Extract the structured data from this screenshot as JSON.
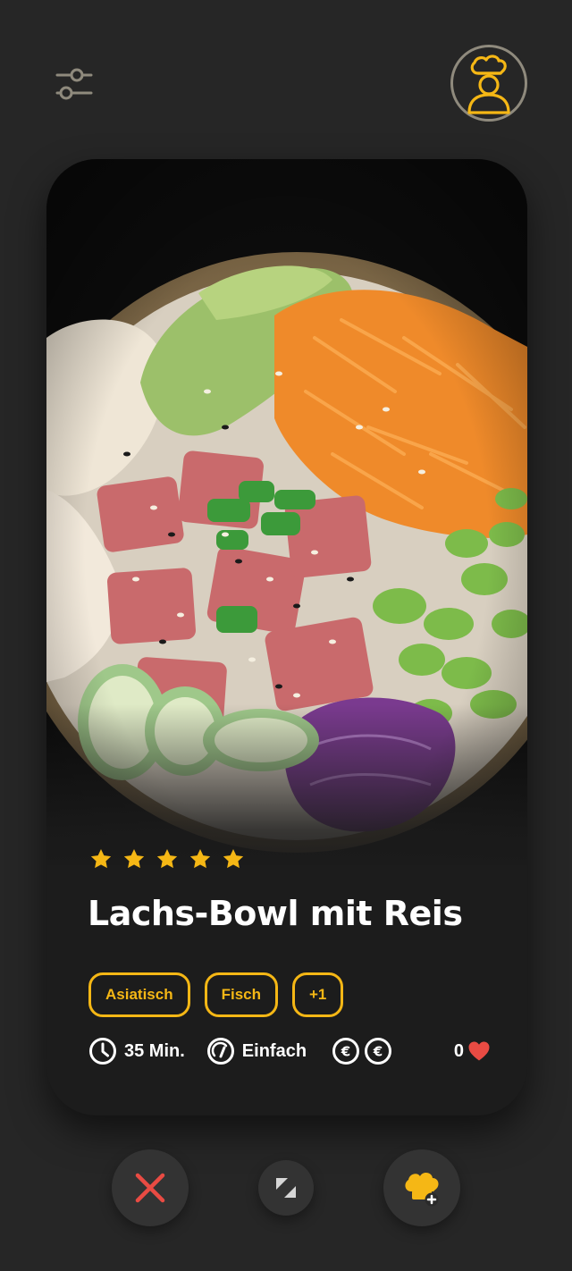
{
  "recipe": {
    "title": "Lachs-Bowl mit Reis",
    "rating": 5,
    "tags": [
      "Asiatisch",
      "Fisch",
      "+1"
    ],
    "time": "35 Min.",
    "difficulty": "Einfach",
    "cost_level": 2,
    "cost_symbol": "€",
    "likes": "0",
    "image": "salmon-poke-bowl-photo"
  },
  "icons": {
    "filter": "sliders-icon",
    "profile": "chef-avatar-icon",
    "time": "clock-icon",
    "difficulty": "gauge-icon",
    "cost": "euro-coin-icon",
    "like": "heart-icon",
    "dislike": "close-icon",
    "expand": "expand-icon",
    "add": "chef-hat-add-icon"
  },
  "colors": {
    "accent": "#f5b715",
    "heart": "#e94b43",
    "dislike": "#e94b43",
    "background": "#262626",
    "card": "#1c1c1c"
  }
}
